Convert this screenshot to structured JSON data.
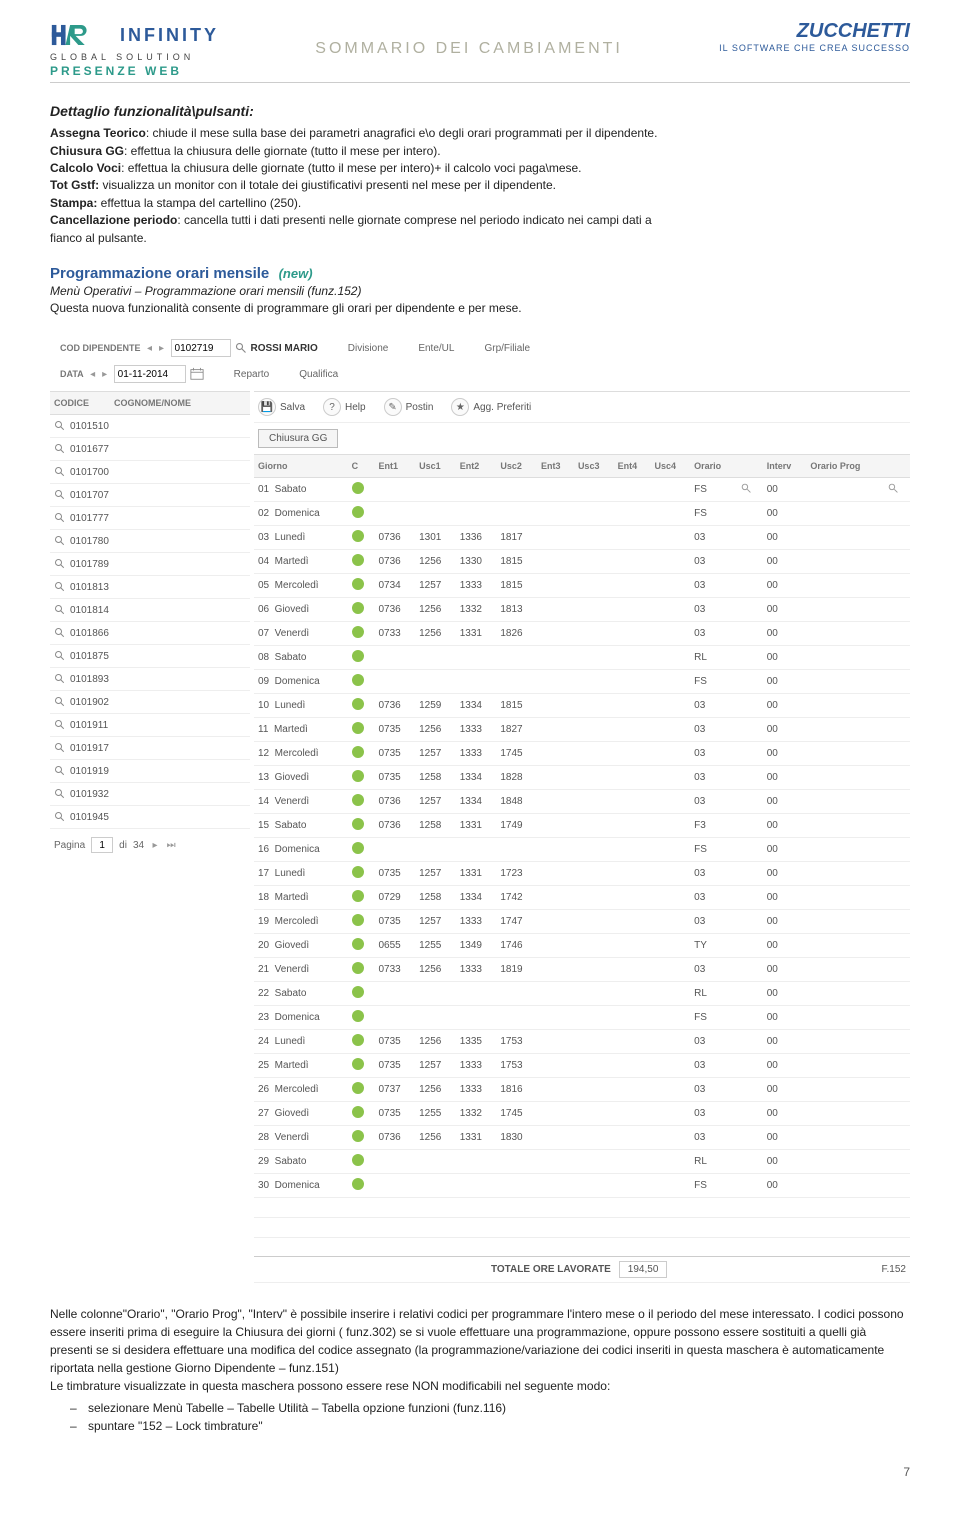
{
  "header": {
    "infinity": "INFINITY",
    "global": "GLOBAL SOLUTION",
    "presenze": "PRESENZE WEB",
    "title": "SOMMARIO DEI CAMBIAMENTI",
    "zucchetti": "ZUCCHETTI",
    "zuc_sub": "IL SOFTWARE CHE CREA SUCCESSO"
  },
  "detail": {
    "heading": "Dettaglio funzionalità\\pulsanti:",
    "items": [
      {
        "k": "Assegna Teorico",
        "v": ": chiude il mese sulla base dei parametri anagrafici e\\o degli orari programmati per il dipendente."
      },
      {
        "k": "Chiusura GG",
        "v": ": effettua la chiusura delle giornate (tutto il mese per intero)."
      },
      {
        "k": "Calcolo Voci",
        "v": ": effettua la chiusura delle giornate (tutto il mese per intero)+ il calcolo voci paga\\mese."
      },
      {
        "k": "Tot Gstf:",
        "v": " visualizza un monitor con il totale dei giustificativi presenti nel mese per il dipendente."
      },
      {
        "k": "Stampa:",
        "v": " effettua la stampa del cartellino (250)."
      },
      {
        "k": "Cancellazione periodo",
        "v": ": cancella tutti i dati presenti nelle giornate comprese nel periodo indicato nei campi dati a"
      }
    ],
    "cancel_cont": "fianco al pulsante."
  },
  "section": {
    "title": "Programmazione orari mensile",
    "new": "(new)",
    "menu": "Menù  Operativi – Programmazione orari mensili (funz.152)",
    "desc": "Questa nuova funzionalità consente di programmare gli orari per dipendente e per mese."
  },
  "ss": {
    "cod_dip_lbl": "COD DIPENDENTE",
    "cod_dip_val": "0102719",
    "name": "ROSSI MARIO",
    "data_lbl": "DATA",
    "data_val": "01-11-2014",
    "flds": {
      "div": "Divisione",
      "rep": "Reparto",
      "ente": "Ente/UL",
      "qual": "Qualifica",
      "grp": "Grp/Filiale"
    },
    "left_head": {
      "c1": "CODICE",
      "c2": "COGNOME/NOME"
    },
    "codes": [
      "0101510",
      "0101677",
      "0101700",
      "0101707",
      "0101777",
      "0101780",
      "0101789",
      "0101813",
      "0101814",
      "0101866",
      "0101875",
      "0101893",
      "0101902",
      "0101911",
      "0101917",
      "0101919",
      "0101932",
      "0101945"
    ],
    "pager": {
      "lbl": "Pagina",
      "cur": "1",
      "of": "di",
      "tot": "34"
    },
    "toolbar": {
      "salva": "Salva",
      "help": "Help",
      "postin": "Postin",
      "agg": "Agg. Preferiti"
    },
    "chiusura_btn": "Chiusura GG",
    "cols": [
      "Giorno",
      "C",
      "Ent1",
      "Usc1",
      "Ent2",
      "Usc2",
      "Ent3",
      "Usc3",
      "Ent4",
      "Usc4",
      "Orario",
      "",
      "Interv",
      "Orario Prog",
      ""
    ],
    "rows": [
      {
        "d": "01",
        "dn": "Sabato",
        "e1": "",
        "u1": "",
        "e2": "",
        "u2": "",
        "or": "FS",
        "iv": "00",
        "op": ""
      },
      {
        "d": "02",
        "dn": "Domenica",
        "e1": "",
        "u1": "",
        "e2": "",
        "u2": "",
        "or": "FS",
        "iv": "00",
        "op": ""
      },
      {
        "d": "03",
        "dn": "Lunedì",
        "e1": "0736",
        "u1": "1301",
        "e2": "1336",
        "u2": "1817",
        "or": "03",
        "iv": "00",
        "op": ""
      },
      {
        "d": "04",
        "dn": "Martedì",
        "e1": "0736",
        "u1": "1256",
        "e2": "1330",
        "u2": "1815",
        "or": "03",
        "iv": "00",
        "op": ""
      },
      {
        "d": "05",
        "dn": "Mercoledì",
        "e1": "0734",
        "u1": "1257",
        "e2": "1333",
        "u2": "1815",
        "or": "03",
        "iv": "00",
        "op": ""
      },
      {
        "d": "06",
        "dn": "Giovedì",
        "e1": "0736",
        "u1": "1256",
        "e2": "1332",
        "u2": "1813",
        "or": "03",
        "iv": "00",
        "op": ""
      },
      {
        "d": "07",
        "dn": "Venerdì",
        "e1": "0733",
        "u1": "1256",
        "e2": "1331",
        "u2": "1826",
        "or": "03",
        "iv": "00",
        "op": ""
      },
      {
        "d": "08",
        "dn": "Sabato",
        "e1": "",
        "u1": "",
        "e2": "",
        "u2": "",
        "or": "RL",
        "iv": "00",
        "op": ""
      },
      {
        "d": "09",
        "dn": "Domenica",
        "e1": "",
        "u1": "",
        "e2": "",
        "u2": "",
        "or": "FS",
        "iv": "00",
        "op": ""
      },
      {
        "d": "10",
        "dn": "Lunedì",
        "e1": "0736",
        "u1": "1259",
        "e2": "1334",
        "u2": "1815",
        "or": "03",
        "iv": "00",
        "op": ""
      },
      {
        "d": "11",
        "dn": "Martedì",
        "e1": "0735",
        "u1": "1256",
        "e2": "1333",
        "u2": "1827",
        "or": "03",
        "iv": "00",
        "op": ""
      },
      {
        "d": "12",
        "dn": "Mercoledì",
        "e1": "0735",
        "u1": "1257",
        "e2": "1333",
        "u2": "1745",
        "or": "03",
        "iv": "00",
        "op": ""
      },
      {
        "d": "13",
        "dn": "Giovedì",
        "e1": "0735",
        "u1": "1258",
        "e2": "1334",
        "u2": "1828",
        "or": "03",
        "iv": "00",
        "op": ""
      },
      {
        "d": "14",
        "dn": "Venerdì",
        "e1": "0736",
        "u1": "1257",
        "e2": "1334",
        "u2": "1848",
        "or": "03",
        "iv": "00",
        "op": ""
      },
      {
        "d": "15",
        "dn": "Sabato",
        "e1": "0736",
        "u1": "1258",
        "e2": "1331",
        "u2": "1749",
        "or": "F3",
        "iv": "00",
        "op": ""
      },
      {
        "d": "16",
        "dn": "Domenica",
        "e1": "",
        "u1": "",
        "e2": "",
        "u2": "",
        "or": "FS",
        "iv": "00",
        "op": ""
      },
      {
        "d": "17",
        "dn": "Lunedì",
        "e1": "0735",
        "u1": "1257",
        "e2": "1331",
        "u2": "1723",
        "or": "03",
        "iv": "00",
        "op": ""
      },
      {
        "d": "18",
        "dn": "Martedì",
        "e1": "0729",
        "u1": "1258",
        "e2": "1334",
        "u2": "1742",
        "or": "03",
        "iv": "00",
        "op": ""
      },
      {
        "d": "19",
        "dn": "Mercoledì",
        "e1": "0735",
        "u1": "1257",
        "e2": "1333",
        "u2": "1747",
        "or": "03",
        "iv": "00",
        "op": ""
      },
      {
        "d": "20",
        "dn": "Giovedì",
        "e1": "0655",
        "u1": "1255",
        "e2": "1349",
        "u2": "1746",
        "or": "TY",
        "iv": "00",
        "op": ""
      },
      {
        "d": "21",
        "dn": "Venerdì",
        "e1": "0733",
        "u1": "1256",
        "e2": "1333",
        "u2": "1819",
        "or": "03",
        "iv": "00",
        "op": ""
      },
      {
        "d": "22",
        "dn": "Sabato",
        "e1": "",
        "u1": "",
        "e2": "",
        "u2": "",
        "or": "RL",
        "iv": "00",
        "op": ""
      },
      {
        "d": "23",
        "dn": "Domenica",
        "e1": "",
        "u1": "",
        "e2": "",
        "u2": "",
        "or": "FS",
        "iv": "00",
        "op": ""
      },
      {
        "d": "24",
        "dn": "Lunedì",
        "e1": "0735",
        "u1": "1256",
        "e2": "1335",
        "u2": "1753",
        "or": "03",
        "iv": "00",
        "op": ""
      },
      {
        "d": "25",
        "dn": "Martedì",
        "e1": "0735",
        "u1": "1257",
        "e2": "1333",
        "u2": "1753",
        "or": "03",
        "iv": "00",
        "op": ""
      },
      {
        "d": "26",
        "dn": "Mercoledì",
        "e1": "0737",
        "u1": "1256",
        "e2": "1333",
        "u2": "1816",
        "or": "03",
        "iv": "00",
        "op": ""
      },
      {
        "d": "27",
        "dn": "Giovedì",
        "e1": "0735",
        "u1": "1255",
        "e2": "1332",
        "u2": "1745",
        "or": "03",
        "iv": "00",
        "op": ""
      },
      {
        "d": "28",
        "dn": "Venerdì",
        "e1": "0736",
        "u1": "1256",
        "e2": "1331",
        "u2": "1830",
        "or": "03",
        "iv": "00",
        "op": ""
      },
      {
        "d": "29",
        "dn": "Sabato",
        "e1": "",
        "u1": "",
        "e2": "",
        "u2": "",
        "or": "RL",
        "iv": "00",
        "op": ""
      },
      {
        "d": "30",
        "dn": "Domenica",
        "e1": "",
        "u1": "",
        "e2": "",
        "u2": "",
        "or": "FS",
        "iv": "00",
        "op": ""
      }
    ],
    "totals_lbl": "TOTALE ORE LAVORATE",
    "totals_val": "194,50",
    "fcode": "F.152"
  },
  "after": {
    "p1a": "Nelle colonne\"Orario\", \"Orario Prog\", \"Interv\" è possibile inserire i relativi codici per programmare l'intero mese o il periodo del mese interessato. I codici possono essere inseriti prima di eseguire la Chiusura dei giorni ( funz.302) se si vuole effettuare una programmazione, oppure possono essere sostituiti a quelli già presenti se si desidera effettuare una modifica del codice assegnato (la programmazione/variazione dei codici inseriti in questa maschera è automaticamente riportata nella gestione Giorno Dipendente – funz.151)",
    "p2": "Le timbrature visualizzate in questa maschera possono essere rese NON modificabili nel seguente modo:",
    "b1": "selezionare Menù Tabelle – Tabelle Utilità – Tabella opzione funzioni (funz.116)",
    "b2": "spuntare  \"152 – Lock timbrature\""
  },
  "page_num": "7"
}
